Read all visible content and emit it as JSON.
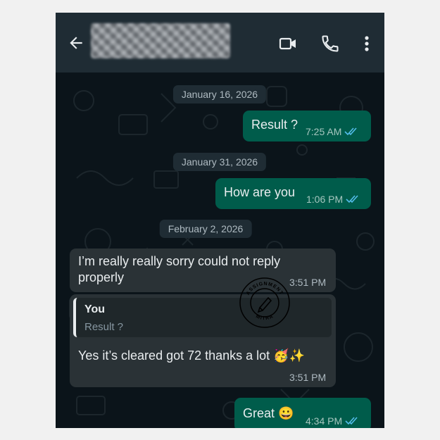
{
  "header": {
    "back_icon": "arrow-left-icon",
    "contact_name_redacted": true,
    "video_icon": "video-call-icon",
    "call_icon": "phone-icon",
    "menu_icon": "more-vert-icon"
  },
  "messages": {
    "date_1": "January 16, 2026",
    "m1": {
      "text": "Result ?",
      "time": "7:25 AM",
      "status": "read"
    },
    "date_2": "January 31, 2026",
    "m2": {
      "text": "How are you",
      "time": "1:06 PM",
      "status": "read"
    },
    "date_3": "February 2, 2026",
    "m3": {
      "line1": "I’m really really sorry could not reply",
      "line2": "properly",
      "time": "3:51 PM"
    },
    "m4": {
      "quote_author": "You",
      "quote_text": "Result ?",
      "text": "Yes it’s cleared got 72 thanks a lot",
      "emoji": "🥳✨",
      "time": "3:51 PM"
    },
    "m5": {
      "text": "Great",
      "emoji": "😀",
      "time": "4:34 PM",
      "status": "read"
    }
  },
  "watermark": {
    "top_text": "ASSIGNMENT",
    "bottom_text": "MITRA",
    "icon": "pencil-icon"
  },
  "colors": {
    "outgoing_bubble": "#005c4b",
    "incoming_bubble": "#2a3236",
    "read_ticks": "#53bdeb",
    "header": "#1f2c34",
    "chat_bg": "#0b141a"
  }
}
